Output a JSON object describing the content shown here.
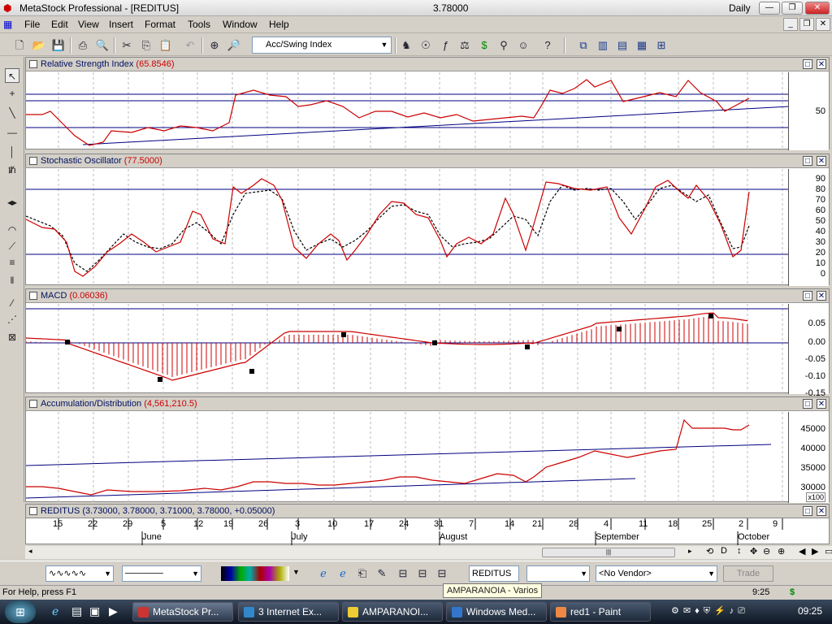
{
  "window": {
    "title": "MetaStock Professional - [REDITUS]",
    "price": "3.78000",
    "period": "Daily"
  },
  "menu": [
    "File",
    "Edit",
    "View",
    "Insert",
    "Format",
    "Tools",
    "Window",
    "Help"
  ],
  "toolbar": {
    "indicator_combo": "Acc/Swing Index"
  },
  "panes": {
    "rsi": {
      "title": "Relative Strength Index",
      "value": "(65.8546)",
      "ticks": [
        "50"
      ]
    },
    "stoch": {
      "title": "Stochastic Oscillator",
      "value": "(77.5000)",
      "ticks": [
        "90",
        "80",
        "70",
        "60",
        "50",
        "40",
        "30",
        "20",
        "10",
        "0"
      ]
    },
    "macd": {
      "title": "MACD",
      "value": "(0.06036)",
      "ticks": [
        "0.05",
        "0.00",
        "-0.05",
        "-0.10",
        "-0.15"
      ]
    },
    "ad": {
      "title": "Accumulation/Distribution",
      "value": "(4,561,210.5)",
      "ticks": [
        "45000",
        "40000",
        "35000",
        "30000"
      ],
      "multiplier": "x100"
    },
    "price": {
      "title": "REDITUS",
      "value": "(3.73000, 3.78000, 3.71000, 3.78000, +0.05000)"
    }
  },
  "dates": {
    "days": [
      "15",
      "22",
      "29",
      "5",
      "12",
      "19",
      "26",
      "3",
      "10",
      "17",
      "24",
      "31",
      "7",
      "14",
      "21",
      "28",
      "4",
      "11",
      "18",
      "25",
      "2",
      "9"
    ],
    "months": [
      "June",
      "July",
      "August",
      "September",
      "October"
    ]
  },
  "bottom": {
    "symbol": "REDITUS",
    "vendor": "<No Vendor>",
    "trade": "Trade"
  },
  "status": {
    "help": "For Help, press F1",
    "time": "9:25",
    "currency": "$"
  },
  "tooltip": "AMPARANOIA - Varios",
  "taskbar": {
    "items": [
      "MetaStock Pr...",
      "3 Internet Ex...",
      "AMPARANOI...",
      "Windows Med...",
      "red1 - Paint"
    ],
    "clock": "09:25"
  },
  "colors": {
    "line": "#cc0000",
    "guide": "#000080",
    "signal": "#000000"
  }
}
